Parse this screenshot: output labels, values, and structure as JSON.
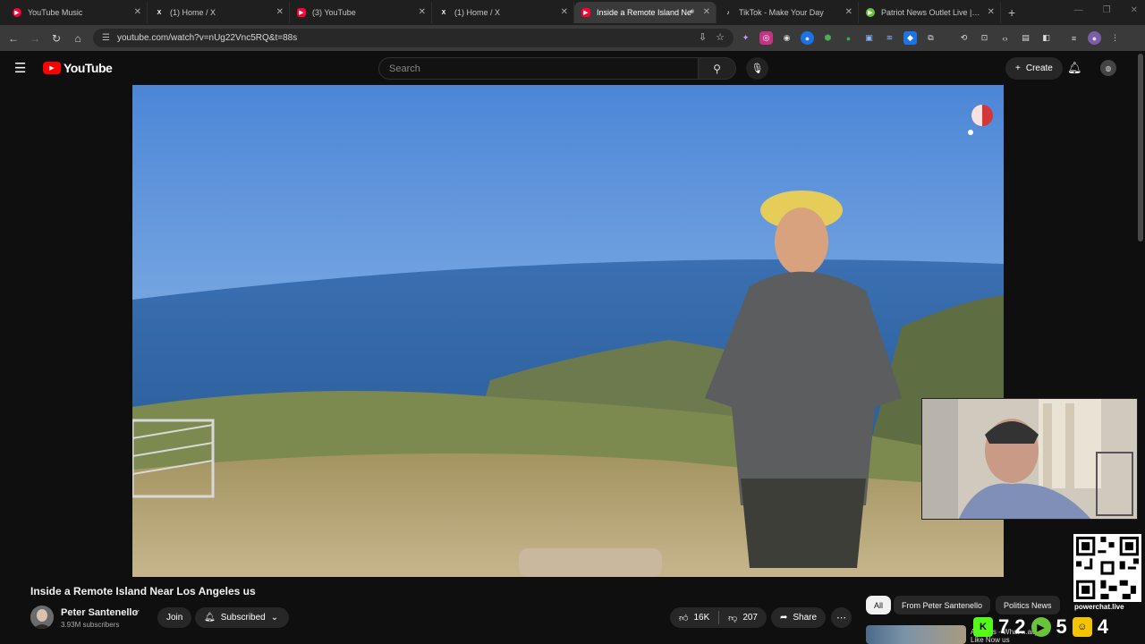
{
  "browser": {
    "tabs": [
      {
        "title": "YouTube Music",
        "icon": "youtube-music-icon",
        "active": false
      },
      {
        "title": "(1) Home / X",
        "icon": "x-icon",
        "active": false
      },
      {
        "title": "(3) YouTube",
        "icon": "youtube-icon",
        "active": false
      },
      {
        "title": "(1) Home / X",
        "icon": "x-icon",
        "active": false
      },
      {
        "title": "Inside a Remote Island Ne",
        "icon": "youtube-icon",
        "active": true
      },
      {
        "title": "TikTok - Make Your Day",
        "icon": "tiktok-icon",
        "active": false
      },
      {
        "title": "Patriot News Outlet Live | Fox N",
        "icon": "rumble-icon",
        "active": false
      }
    ],
    "url": "youtube.com/watch?v=nUg22Vnc5RQ&t=88s"
  },
  "youtube": {
    "logo_text": "YouTube",
    "search_placeholder": "Search",
    "create_label": "Create"
  },
  "video": {
    "title": "Inside a Remote Island Near Los Angeles us",
    "channel_name": "Peter Santenello",
    "subscribers": "3.93M subscribers",
    "join_label": "Join",
    "subscribed_label": "Subscribed",
    "likes": "16K",
    "dislikes": "207",
    "share_label": "Share"
  },
  "chips": [
    "All",
    "From Peter Santenello",
    "Politics News"
  ],
  "recommendation": {
    "partial_title": "Angeles - What ...ally",
    "partial_subtitle": "Like Now us"
  },
  "stream_overlay": {
    "powerchat_label": "powerchat.live",
    "counts": [
      "7",
      "2",
      "5",
      "4"
    ]
  },
  "colors": {
    "youtube_red": "#ff0000",
    "background": "#0f0f0f",
    "chip_bg": "#272727"
  }
}
